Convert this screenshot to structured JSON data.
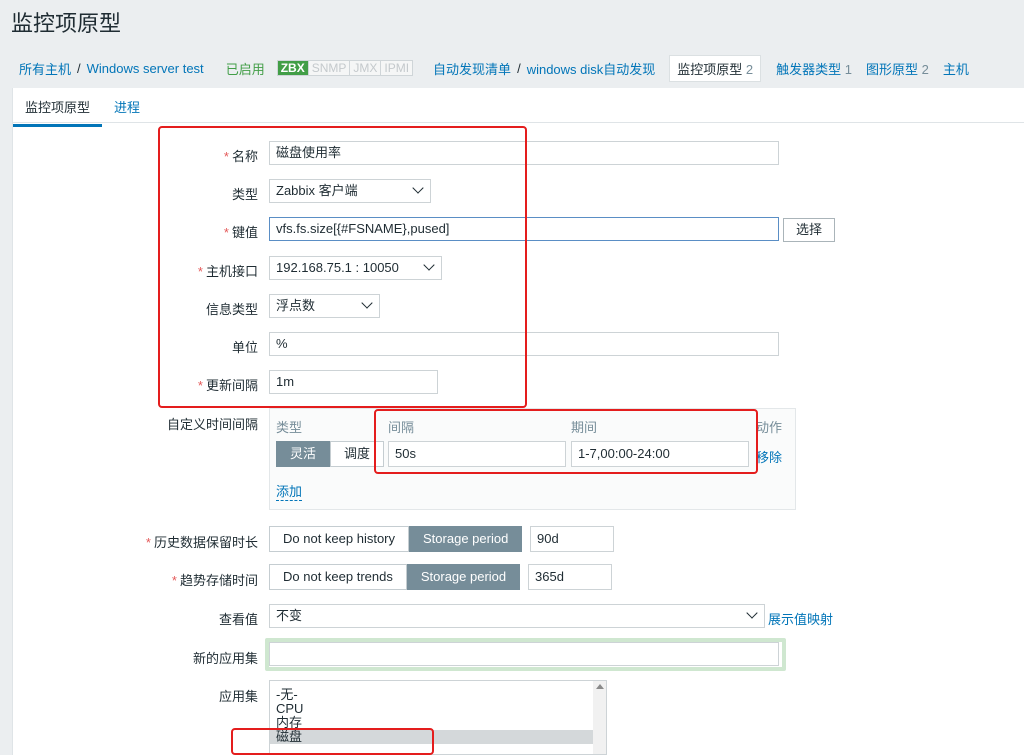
{
  "page": {
    "title": "监控项原型"
  },
  "breadcrumb": {
    "all_hosts": "所有主机",
    "sep": "/",
    "host": "Windows server test",
    "status": "已启用",
    "badges": [
      "ZBX",
      "SNMP",
      "JMX",
      "IPMI"
    ],
    "discovery_list": "自动发现清单",
    "discovery_rule": "windows disk自动发现",
    "tabs": [
      {
        "label": "监控项原型",
        "count": "2"
      },
      {
        "label": "触发器类型",
        "count": "1"
      },
      {
        "label": "图形原型",
        "count": "2"
      },
      {
        "label": "主机"
      }
    ]
  },
  "tabs": {
    "item": "监控项原型",
    "process": "进程"
  },
  "form": {
    "name_label": "名称",
    "name_value": "磁盘使用率",
    "type_label": "类型",
    "type_value": "Zabbix 客户端",
    "key_label": "键值",
    "key_value": "vfs.fs.size[{#FSNAME},pused]",
    "select_button": "选择",
    "interface_label": "主机接口",
    "interface_value": "192.168.75.1 : 10050",
    "info_type_label": "信息类型",
    "info_type_value": "浮点数",
    "units_label": "单位",
    "units_value": "%",
    "interval_label": "更新间隔",
    "interval_value": "1m",
    "custom_label": "自定义时间间隔",
    "custom": {
      "col_type": "类型",
      "col_interval": "间隔",
      "col_period": "期间",
      "col_action": "动作",
      "flexible": "灵活",
      "scheduling": "调度",
      "interval": "50s",
      "period": "1-7,00:00-24:00",
      "remove": "移除",
      "add": "添加"
    },
    "history_label": "历史数据保留时长",
    "history_opt1": "Do not keep history",
    "history_opt2": "Storage period",
    "history_value": "90d",
    "trends_label": "趋势存储时间",
    "trends_opt1": "Do not keep trends",
    "trends_opt2": "Storage period",
    "trends_value": "365d",
    "valuemap_label": "查看值",
    "valuemap_value": "不变",
    "valuemap_link": "展示值映射",
    "new_app_label": "新的应用集",
    "new_app_value": "",
    "apps_label": "应用集",
    "apps": [
      "-无-",
      "CPU",
      "内存",
      "磁盘"
    ],
    "apps_selected": "磁盘"
  },
  "colors": {
    "annotation": "#e41d1d",
    "link": "#0275b8",
    "enabled": "#429e47"
  }
}
